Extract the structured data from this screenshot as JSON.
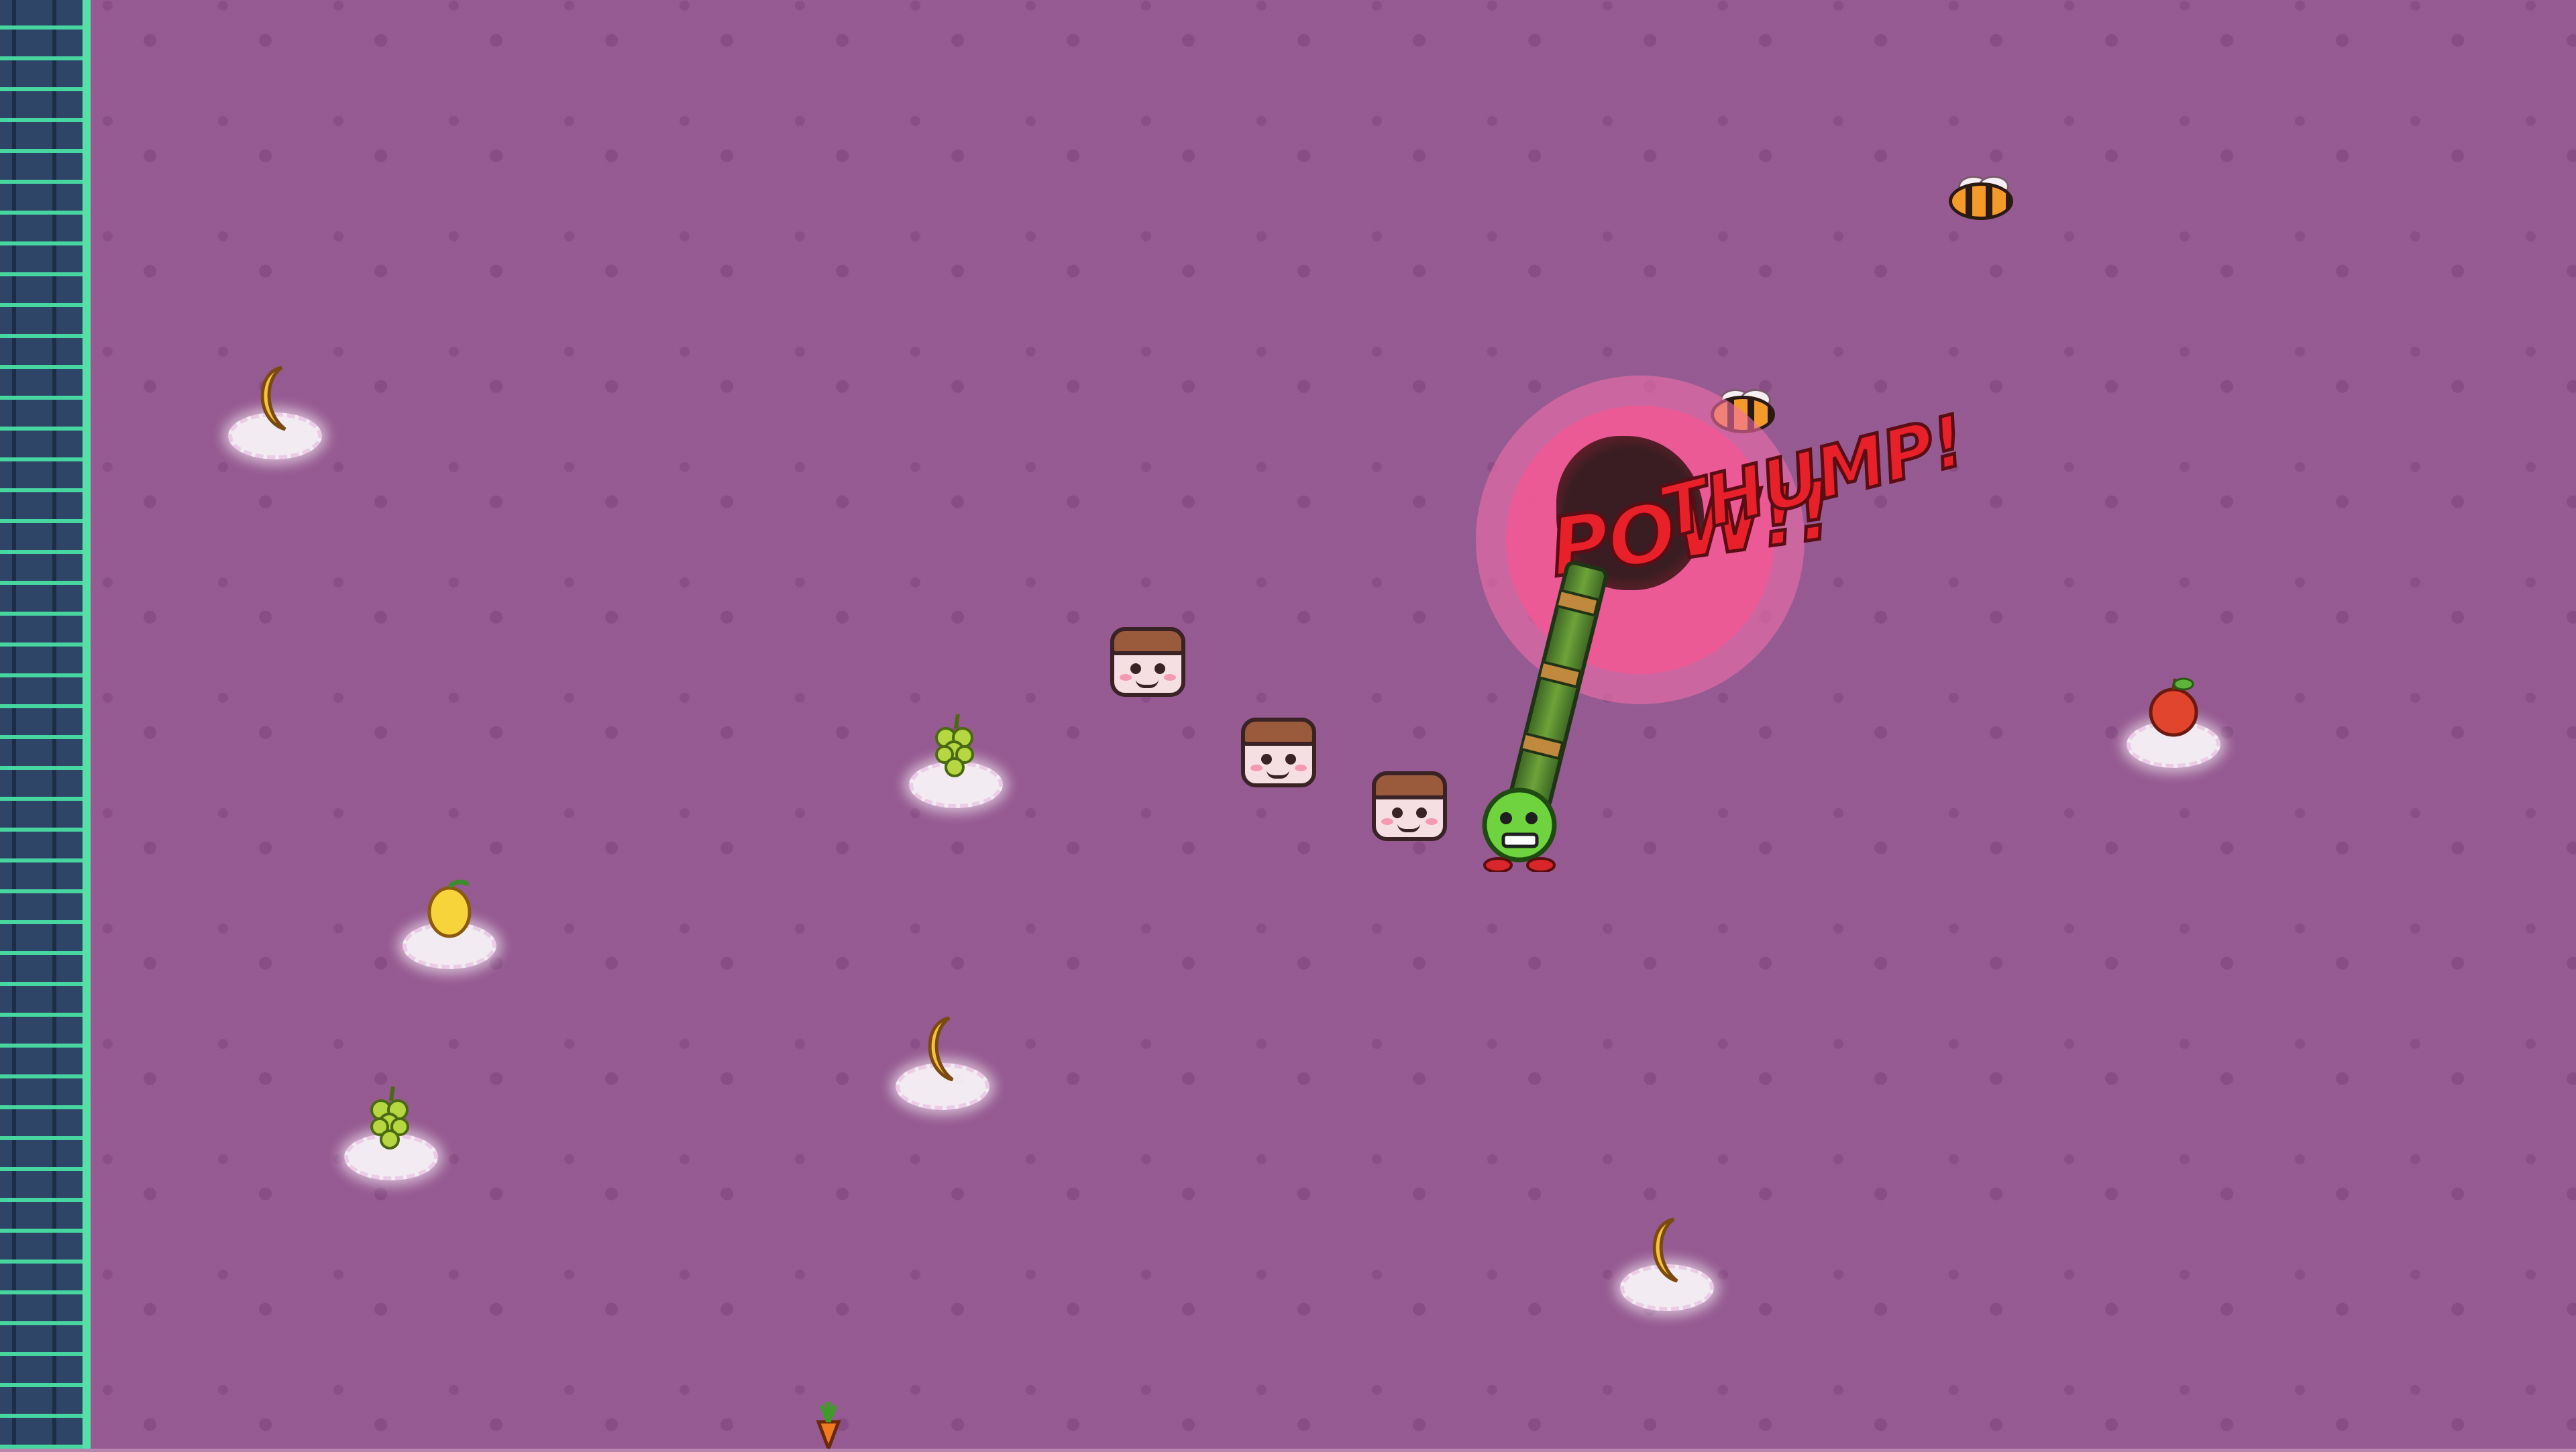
{
  "game": {
    "title": "",
    "hud": {}
  },
  "effects": {
    "hit_text_1": "THUMP!",
    "hit_text_2": "POW!!"
  },
  "colors": {
    "floor": "#b784ae",
    "floor_tile": "#9a5596",
    "wall": "#2f4567",
    "wall_accent": "#57e0a6",
    "explosion": "#f05a96",
    "hit_text": "#e8202a"
  },
  "entities": {
    "player": {
      "name": "player",
      "icon": "green-blob-player-icon"
    },
    "weapon": {
      "name": "rocket-launcher",
      "icon": "rocket-launcher-icon"
    },
    "enemies": [
      {
        "icon": "box-head-enemy-icon"
      },
      {
        "icon": "box-head-enemy-icon"
      },
      {
        "icon": "box-head-enemy-icon"
      },
      {
        "icon": "bee-enemy-icon"
      },
      {
        "icon": "bee-enemy-icon"
      }
    ],
    "pickups": [
      {
        "fruit": "banana"
      },
      {
        "fruit": "grapes"
      },
      {
        "fruit": "lemon"
      },
      {
        "fruit": "banana"
      },
      {
        "fruit": "grapes"
      },
      {
        "fruit": "apple"
      },
      {
        "fruit": "banana"
      },
      {
        "fruit": "carrot"
      }
    ]
  }
}
